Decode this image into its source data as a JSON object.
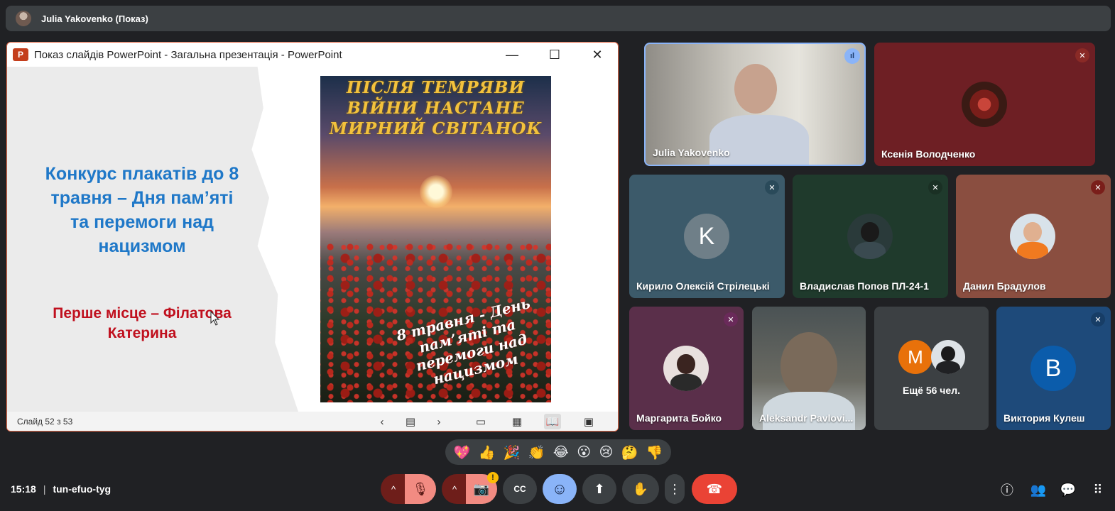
{
  "presenter_bar": {
    "title": "Julia Yakovenko (Показ)"
  },
  "ppt_window": {
    "title": "Показ слайдів PowerPoint  -  Загальна презентація - PowerPoint",
    "logo": "P",
    "min": "—",
    "max": "☐",
    "close": "✕",
    "slide": {
      "heading": "Конкурс плакатів до 8 травня – Дня пам’яті та перемоги над нацизмом",
      "winner": "Перше місце – Філатова Катерина",
      "poster_top": "ПІСЛЯ ТЕМРЯВИ ВІЙНИ НАСТАНЕ МИРНИЙ СВІТАНОК",
      "poster_bottom": "8 травня - День пам’яті та перемоги над нацизмом"
    },
    "status": "Слайд 52 з 53"
  },
  "participants": [
    {
      "name": "Julia Yakovenko"
    },
    {
      "name": "Ксенія Володченко"
    },
    {
      "name": "Кирило Олексій Стрілецькі",
      "letter": "K"
    },
    {
      "name": "Владислав Попов ПЛ-24-1"
    },
    {
      "name": "Данил Брадулов"
    },
    {
      "name": "Маргарита Бойко"
    },
    {
      "name": "Aleksandr Pavlovi..."
    },
    {
      "name": "Ещё 56 чел.",
      "letter": "M"
    },
    {
      "name": "Виктория Кулеш",
      "letter": "B"
    }
  ],
  "reactions": [
    "💖",
    "👍",
    "🎉",
    "👏",
    "😂",
    "😮",
    "😢",
    "🤔",
    "👎"
  ],
  "meeting": {
    "time": "15:18",
    "separator": "|",
    "code": "tun-efuo-tyg"
  },
  "icons": {
    "caret": "^",
    "mic_off": "🎙",
    "cam_off": "📷",
    "captions": "CC",
    "emoji": "☺",
    "present": "⬆",
    "hand": "✋",
    "more": "⋮",
    "hangup": "☎",
    "info": "ⓘ",
    "people": "👥",
    "chat": "💬",
    "activities": "⠿",
    "warning": "!",
    "prev": "‹",
    "next": "›",
    "notes": "▤",
    "normal": "▭",
    "sorter": "▦",
    "reading": "📖",
    "slideshow": "▣"
  },
  "colors": {
    "accent_blue": "#8ab4f8",
    "hangup_red": "#ea4335",
    "muted_red": "#f28b82"
  }
}
